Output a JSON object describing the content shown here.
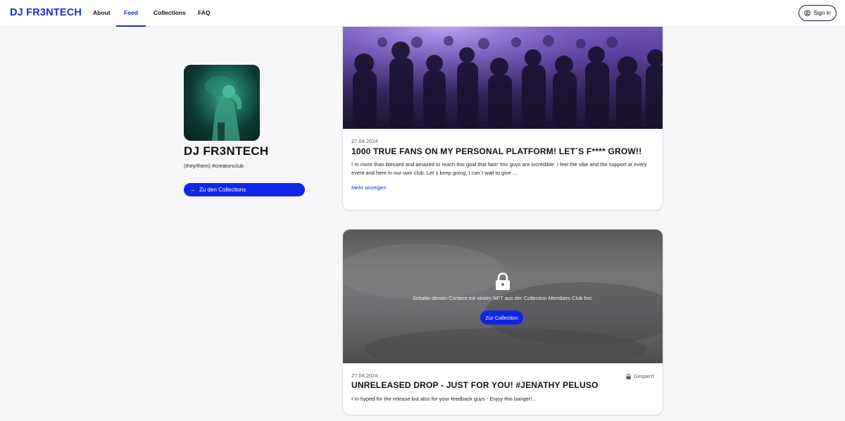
{
  "header": {
    "brand": "DJ FR3NTECH",
    "nav": [
      {
        "label": "About"
      },
      {
        "label": "Feed"
      },
      {
        "label": "Collections"
      },
      {
        "label": "FAQ"
      }
    ],
    "active_nav": "Feed",
    "sign_in_label": "Sign in",
    "accent": "#1a2fd8"
  },
  "profile": {
    "name": "DJ FR3NTECH",
    "tagline": "(they/them) #creatorsclub",
    "collections_button": "Zu den Collections",
    "button_icon": "arrow-right-icon"
  },
  "posts": [
    {
      "date": "27.04.2024",
      "title": "1000 TRUE FANS ON MY PERSONAL PLATFORM! LET´S F**** GROW!!",
      "body": "I´m more than blessed and amazed to reach this goal that fast! You guys are incredible. I feel the vibe and the support at every event and here in our own club. Let´s keep going, I can´t wait to give ...",
      "more_label": "Mehr anzeigen",
      "locked": false
    },
    {
      "date": "27.04.2024",
      "title": "UNRELEASED DROP - JUST FOR YOU! #JENATHY PELUSO",
      "body": "I´m hyped for the release but also for your feedback guys - Enjoy this banger!...",
      "locked": true,
      "locked_badge": "Gesperrt",
      "unlock_text": "Schalte diesen Content mit einem NFT aus der Collection Members Club frei.",
      "unlock_button": "Zur Collection"
    }
  ],
  "colors": {
    "primary_button": "#1026e6",
    "background": "#f7f7f9"
  }
}
